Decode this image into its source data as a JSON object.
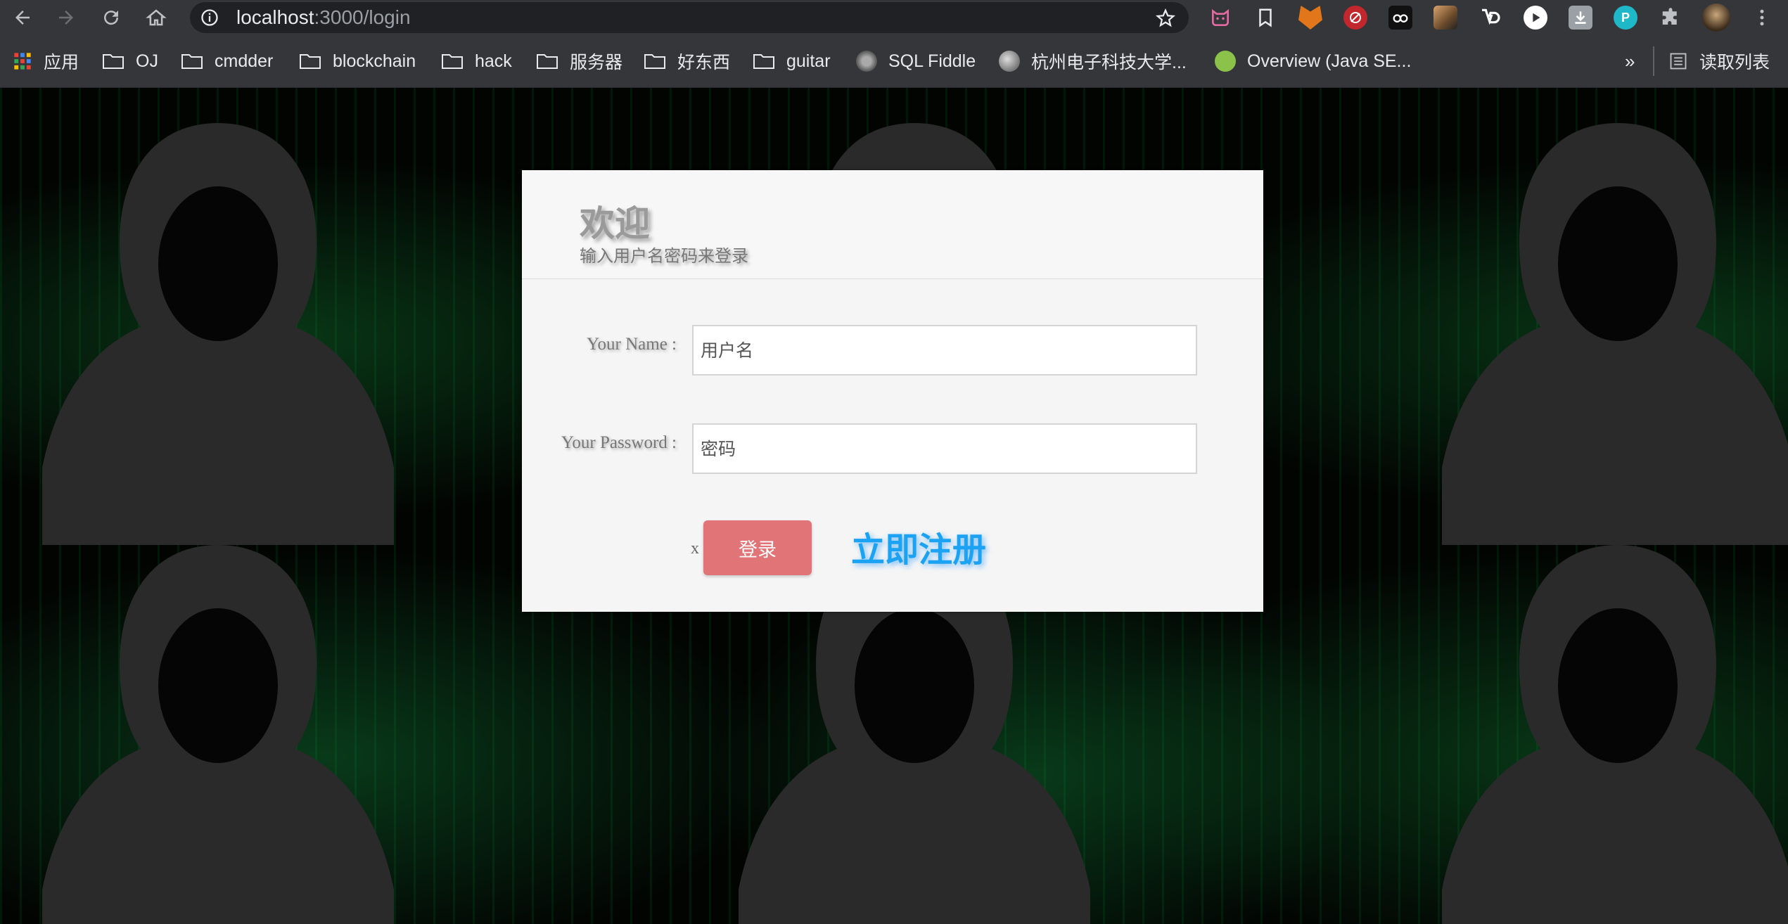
{
  "browser": {
    "url_host": "localhost",
    "url_rest": ":3000/login",
    "extensions": [
      {
        "name": "cat-extension-icon",
        "color": "#e46aa2"
      },
      {
        "name": "bookmark-extension-icon",
        "color": "#35363a"
      },
      {
        "name": "metamask-fox-icon",
        "color": "#e2761b"
      },
      {
        "name": "no-tracking-icon",
        "color": "#c2272d"
      },
      {
        "name": "goggles-extension-icon",
        "color": "#222"
      },
      {
        "name": "pixel-avatar-extension-icon",
        "color": "#6b4a2b"
      },
      {
        "name": "vd-extension-icon",
        "color": "#35363a"
      },
      {
        "name": "play-extension-icon",
        "color": "#35363a"
      },
      {
        "name": "download-extension-icon",
        "color": "#888"
      },
      {
        "name": "p-extension-icon",
        "color": "#1fb8c9"
      }
    ],
    "p_ext_label": "P"
  },
  "bookmarks": {
    "apps_label": "应用",
    "items": [
      {
        "label": "OJ"
      },
      {
        "label": "cmdder"
      },
      {
        "label": "blockchain"
      },
      {
        "label": "hack"
      },
      {
        "label": "服务器"
      },
      {
        "label": "好东西"
      },
      {
        "label": "guitar"
      },
      {
        "label": "SQL Fiddle"
      },
      {
        "label": "杭州电子科技大学..."
      },
      {
        "label": "Overview (Java SE..."
      }
    ],
    "overflow": "»",
    "reading_list": "读取列表"
  },
  "login": {
    "title": "欢迎",
    "subtitle": "输入用户名密码来登录",
    "name_label": "Your Name :",
    "name_placeholder": "用户名",
    "password_label": "Your Password :",
    "password_placeholder": "密码",
    "x_mark": "x",
    "submit_label": "登录",
    "register_label": "立即注册"
  },
  "colors": {
    "chrome_bg": "#35363a",
    "login_button": "#e07476",
    "register_link": "#1ca2f3"
  }
}
